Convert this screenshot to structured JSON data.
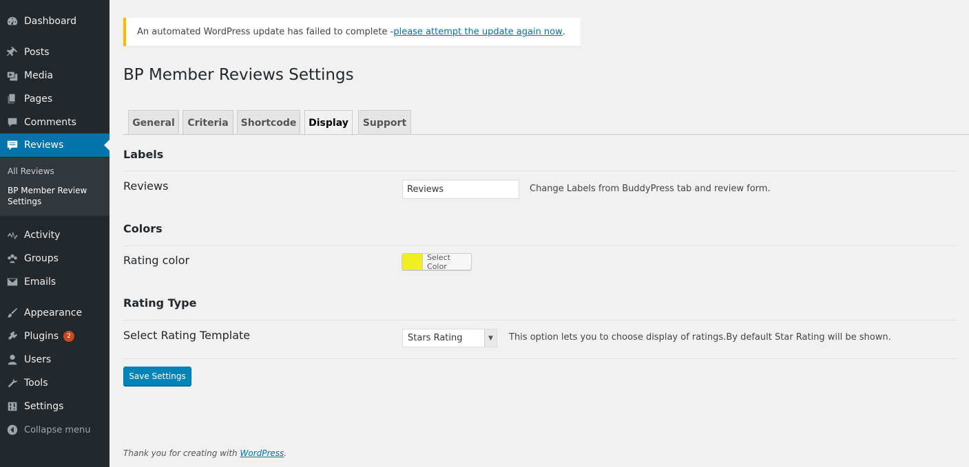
{
  "sidebar": {
    "items": [
      {
        "label": "Dashboard",
        "icon": "dashboard-icon"
      },
      {
        "label": "Posts",
        "icon": "pin-icon"
      },
      {
        "label": "Media",
        "icon": "media-icon"
      },
      {
        "label": "Pages",
        "icon": "pages-icon"
      },
      {
        "label": "Comments",
        "icon": "comment-icon"
      },
      {
        "label": "Reviews",
        "icon": "reviews-icon"
      },
      {
        "label": "Activity",
        "icon": "activity-icon"
      },
      {
        "label": "Groups",
        "icon": "groups-icon"
      },
      {
        "label": "Emails",
        "icon": "email-icon"
      },
      {
        "label": "Appearance",
        "icon": "brush-icon"
      },
      {
        "label": "Plugins",
        "icon": "plugin-icon",
        "badge": "2"
      },
      {
        "label": "Users",
        "icon": "user-icon"
      },
      {
        "label": "Tools",
        "icon": "wrench-icon"
      },
      {
        "label": "Settings",
        "icon": "settings-icon"
      }
    ],
    "submenu": [
      "All Reviews",
      "BP Member Review Settings"
    ],
    "collapse_label": "Collapse menu"
  },
  "notice": {
    "text": "An automated WordPress update has failed to complete - ",
    "link": "please attempt the update again now",
    "suffix": "."
  },
  "page_title": "BP Member Reviews Settings",
  "tabs": [
    "General",
    "Criteria",
    "Shortcode",
    "Display",
    "Support"
  ],
  "active_tab": "Display",
  "sections": {
    "labels": {
      "title": "Labels",
      "reviews_label": "Reviews",
      "reviews_value": "Reviews",
      "reviews_desc": "Change Labels from BuddyPress tab and review form."
    },
    "colors": {
      "title": "Colors",
      "rating_label": "Rating color",
      "button_label": "Select Color",
      "color": "#eeee22"
    },
    "rating_type": {
      "title": "Rating Type",
      "template_label": "Select Rating Template",
      "selected": "Stars Rating",
      "desc": "This option lets you to choose display of ratings.By default Star Rating will be shown."
    }
  },
  "save_label": "Save Settings",
  "footer": {
    "text": "Thank you for creating with ",
    "link": "WordPress",
    "suffix": "."
  },
  "colors": {
    "sidebar": "#23282d",
    "accent": "#0073aa",
    "notice_border": "#ffb900",
    "badge": "#ca4a1f"
  }
}
